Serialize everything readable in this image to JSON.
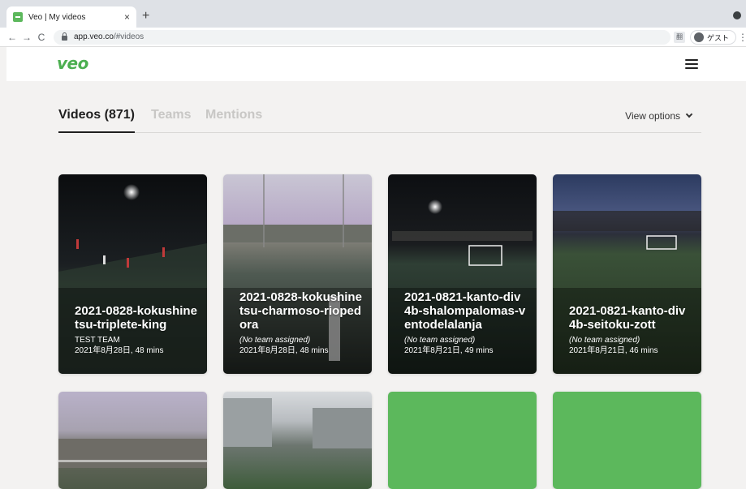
{
  "browser": {
    "tab_title": "Veo | My videos",
    "tab_close": "×",
    "new_tab": "+",
    "back": "←",
    "forward": "→",
    "reload": "C",
    "url_host": "app.veo.co",
    "url_path": "/#videos",
    "translate": "翻",
    "profile_label": "ゲスト",
    "menu": "⋮"
  },
  "app": {
    "logo": "veo"
  },
  "nav": {
    "tabs": [
      {
        "label": "Videos (871)",
        "active": true
      },
      {
        "label": "Teams",
        "active": false
      },
      {
        "label": "Mentions",
        "active": false
      }
    ],
    "view_options": "View options"
  },
  "videos": [
    {
      "title": "2021-0828-kokushinetsu-triplete-king",
      "team": "TEST TEAM",
      "meta": "2021年8月28日, 48 mins"
    },
    {
      "title": "2021-0828-kokushinetsu-charmoso-riopedora",
      "team": "(No team assigned)",
      "meta": "2021年8月28日, 48 mins"
    },
    {
      "title": "2021-0821-kanto-div4b-shalompalomas-ventodelalanja",
      "team": "(No team assigned)",
      "meta": "2021年8月21日, 49 mins"
    },
    {
      "title": "2021-0821-kanto-div4b-seitoku-zott",
      "team": "(No team assigned)",
      "meta": "2021年8月21日, 46 mins"
    }
  ],
  "colors": {
    "brand_green": "#5cb85c",
    "background": "#f3f2f1"
  },
  "icons": [
    "close-icon",
    "plus-icon",
    "back-arrow-icon",
    "forward-arrow-icon",
    "reload-icon",
    "lock-icon",
    "translate-icon",
    "profile-icon",
    "kebab-menu-icon",
    "hamburger-menu-icon",
    "chevron-down-icon"
  ]
}
